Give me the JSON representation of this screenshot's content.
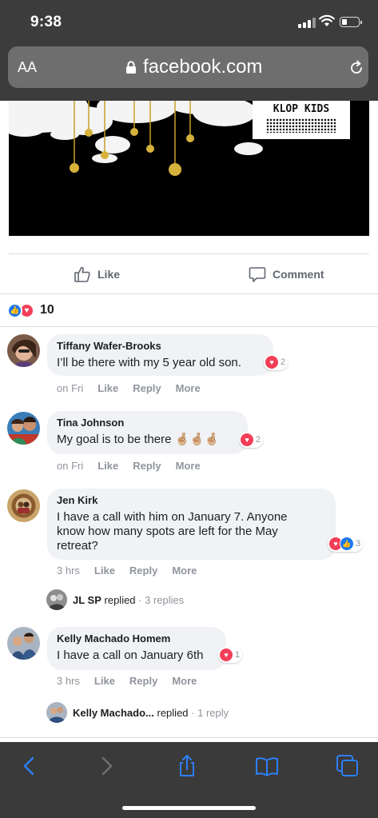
{
  "status_bar": {
    "time": "9:38"
  },
  "browser": {
    "aa_label": "AA",
    "url": "facebook.com"
  },
  "post": {
    "image_badge_text": "KLOP KIDS",
    "actions": {
      "like": "Like",
      "comment": "Comment"
    },
    "reactions": {
      "count": "10",
      "types": [
        "like-icon",
        "love-icon"
      ]
    }
  },
  "comments": [
    {
      "author": "Tiffany Wafer-Brooks",
      "text": "I’ll be there with my 5 year old son.",
      "reaction_count": "2",
      "reaction_types": [
        "love-icon"
      ],
      "time": "on Fri",
      "like": "Like",
      "reply": "Reply",
      "more": "More"
    },
    {
      "author": "Tina Johnson",
      "text": "My goal is to be there 🤞🏼🤞🏼🤞🏼",
      "reaction_count": "2",
      "reaction_types": [
        "love-icon"
      ],
      "time": "on Fri",
      "like": "Like",
      "reply": "Reply",
      "more": "More"
    },
    {
      "author": "Jen Kirk",
      "text_lines": [
        "I have a call with him on January 7. Anyone",
        "know how many spots are left for the May",
        "retreat?"
      ],
      "reaction_count": "3",
      "reaction_types": [
        "love-icon",
        "like-icon"
      ],
      "time": "3 hrs",
      "like": "Like",
      "reply": "Reply",
      "more": "More",
      "replies": {
        "name": "JL SP",
        "action": "replied",
        "sep": "·",
        "count": "3 replies"
      }
    },
    {
      "author": "Kelly Machado Homem",
      "text": "I have a call on January 6th",
      "reaction_count": "1",
      "reaction_types": [
        "love-icon"
      ],
      "time": "3 hrs",
      "like": "Like",
      "reply": "Reply",
      "more": "More",
      "replies": {
        "name": "Kelly Machado...",
        "action": "replied",
        "sep": "·",
        "count": "1 reply"
      }
    }
  ],
  "toolbar": {
    "icons": [
      "back-icon",
      "forward-icon",
      "share-icon",
      "bookmarks-icon",
      "tabs-icon"
    ],
    "accent": "#2d7ff9",
    "disabled": "#707070"
  }
}
